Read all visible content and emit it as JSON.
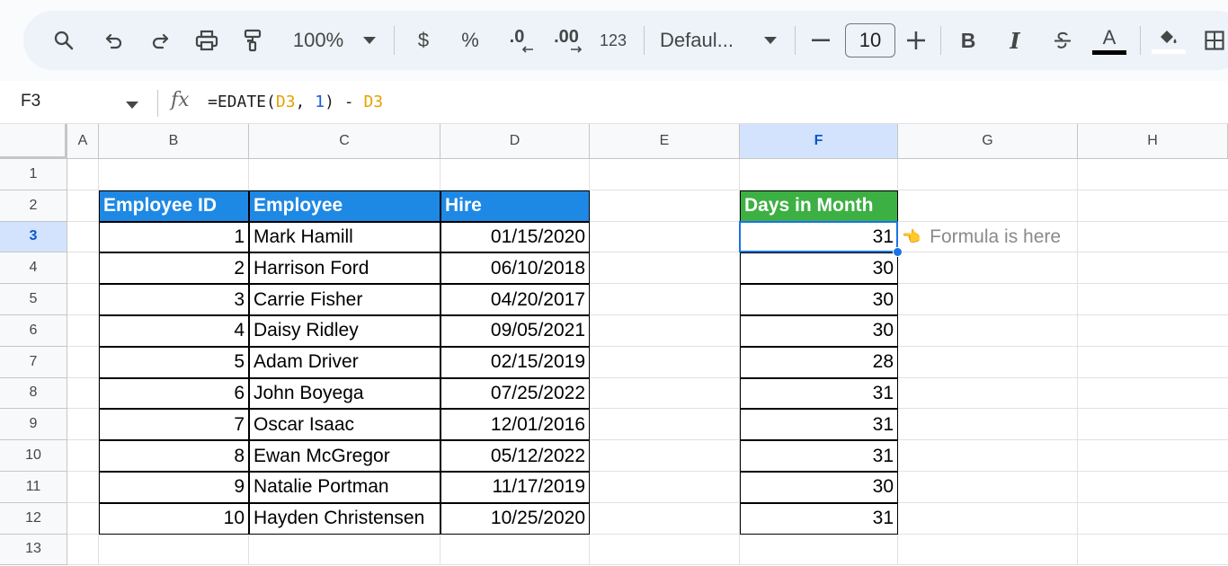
{
  "toolbar": {
    "zoom": "100%",
    "currency_symbol": "$",
    "percent_symbol": "%",
    "decrease_decimals": ".0",
    "increase_decimals": ".00",
    "number_format": "123",
    "font_name": "Defaul...",
    "font_size": "10",
    "bold_label": "B",
    "italic_label": "I",
    "text_color_label": "A"
  },
  "formula_bar": {
    "cell_ref": "F3",
    "formula": {
      "p1": "=EDATE(",
      "ref1": "D3",
      "p2": ", ",
      "num": "1",
      "p3": ") - ",
      "ref2": "D3"
    }
  },
  "columns": [
    "A",
    "B",
    "C",
    "D",
    "E",
    "F",
    "G",
    "H"
  ],
  "selected_column": "F",
  "rows": [
    "1",
    "2",
    "3",
    "4",
    "5",
    "6",
    "7",
    "8",
    "9",
    "10",
    "11",
    "12",
    "13"
  ],
  "selected_row": "3",
  "table": {
    "headers": [
      "Employee ID",
      "Employee",
      "Hire"
    ],
    "rows": [
      [
        "1",
        "Mark Hamill",
        "01/15/2020"
      ],
      [
        "2",
        "Harrison Ford",
        "06/10/2018"
      ],
      [
        "3",
        "Carrie Fisher",
        "04/20/2017"
      ],
      [
        "4",
        "Daisy Ridley",
        "09/05/2021"
      ],
      [
        "5",
        "Adam Driver",
        "02/15/2019"
      ],
      [
        "6",
        "John Boyega",
        "07/25/2022"
      ],
      [
        "7",
        "Oscar Isaac",
        "12/01/2016"
      ],
      [
        "8",
        "Ewan McGregor",
        "05/12/2022"
      ],
      [
        "9",
        "Natalie Portman",
        "11/17/2019"
      ],
      [
        "10",
        "Hayden Christensen",
        "10/25/2020"
      ]
    ]
  },
  "days": {
    "header": "Days in Month",
    "values": [
      "31",
      "30",
      "30",
      "30",
      "28",
      "31",
      "31",
      "31",
      "30",
      "31"
    ]
  },
  "note": {
    "emoji": "👈",
    "text": "Formula is here"
  },
  "colors": {
    "table_header": "#1e88e5",
    "days_header": "#3cb043",
    "selection": "#1a73e8",
    "cell_ref": "#e8a100",
    "number_literal": "#1a5fd6"
  }
}
